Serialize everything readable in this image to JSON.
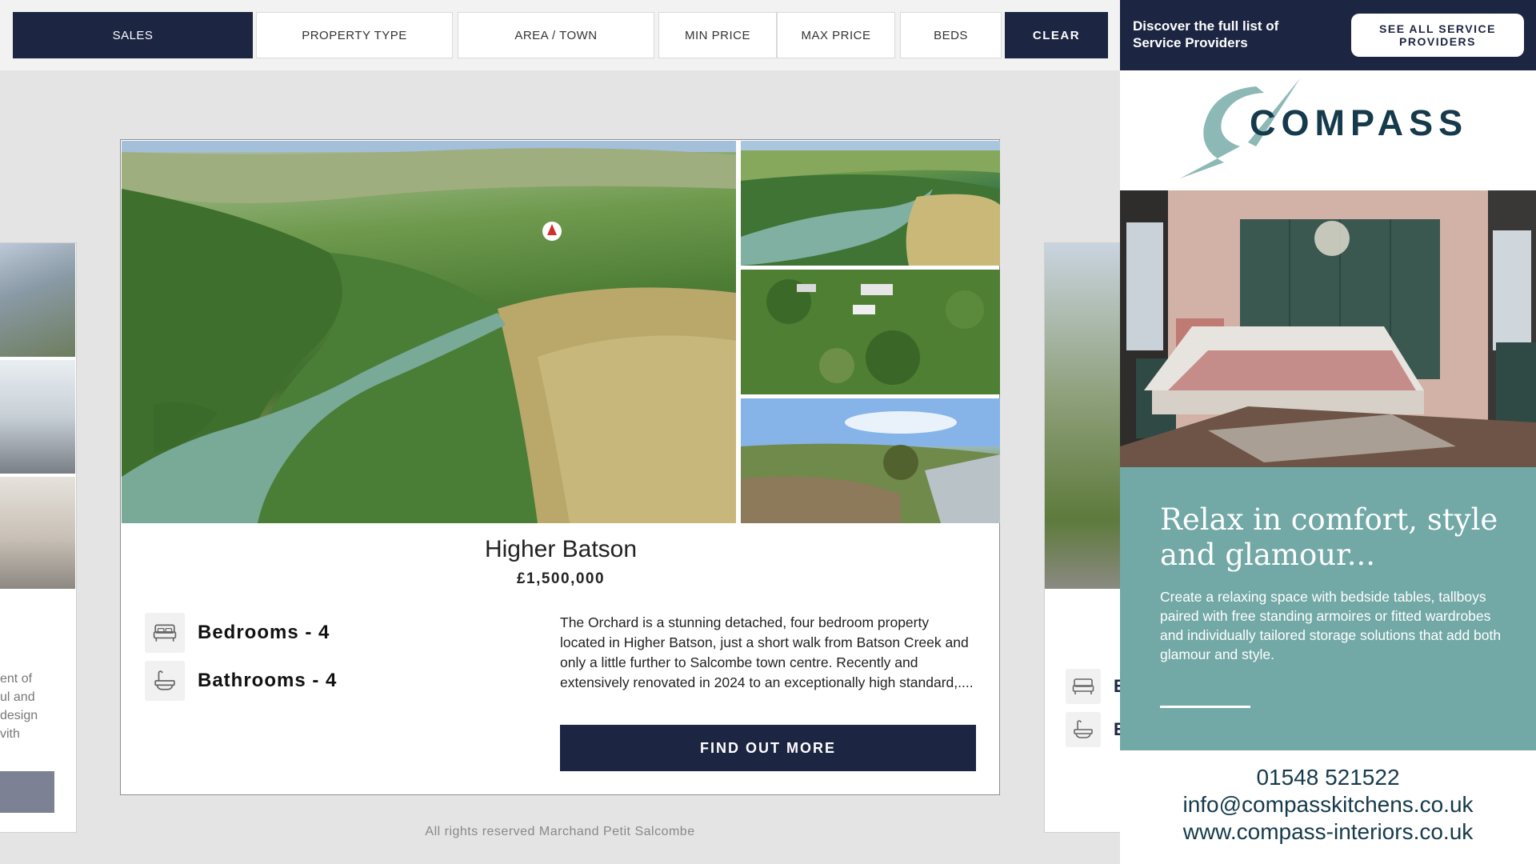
{
  "filters": {
    "sales": "SALES",
    "property_type": "PROPERTY TYPE",
    "area_town": "AREA / TOWN",
    "min_price": "MIN PRICE",
    "max_price": "MAX PRICE",
    "beds": "BEDS",
    "clear": "CLEAR"
  },
  "left_peek": {
    "text_lines": [
      "ent of",
      "ul and",
      "design",
      "vith"
    ]
  },
  "right_peek": {
    "letters": [
      "E",
      "E"
    ]
  },
  "property": {
    "title": "Higher Batson",
    "price": "£1,500,000",
    "bedrooms": "Bedrooms - 4",
    "bathrooms": "Bathrooms - 4",
    "description": "The Orchard is a stunning detached, four bedroom property located in Higher Batson, just a short walk from Batson Creek and only a little further to Salcombe town centre. Recently and extensively renovated in 2024 to an exceptionally high standard,....",
    "cta": "FIND OUT MORE"
  },
  "footer": {
    "text": "All rights reserved Marchand Petit Salcombe"
  },
  "sidebar": {
    "header_text": "Discover the full list of Service Providers",
    "header_button": "SEE ALL SERVICE PROVIDERS",
    "ad": {
      "logo": "COMPASS",
      "headline": "Relax in comfort, style and glamour...",
      "body": "Create a relaxing space with bedside tables, tallboys paired with free standing armoires or fitted wardrobes and individually tailored storage solutions that add both glamour and style.",
      "phone": "01548 521522",
      "email": "info@compasskitchens.co.uk",
      "website": "www.compass-interiors.co.uk"
    }
  },
  "colors": {
    "navy": "#1c2541",
    "teal": "#72a8a6",
    "page_bg": "#e4e4e4"
  }
}
